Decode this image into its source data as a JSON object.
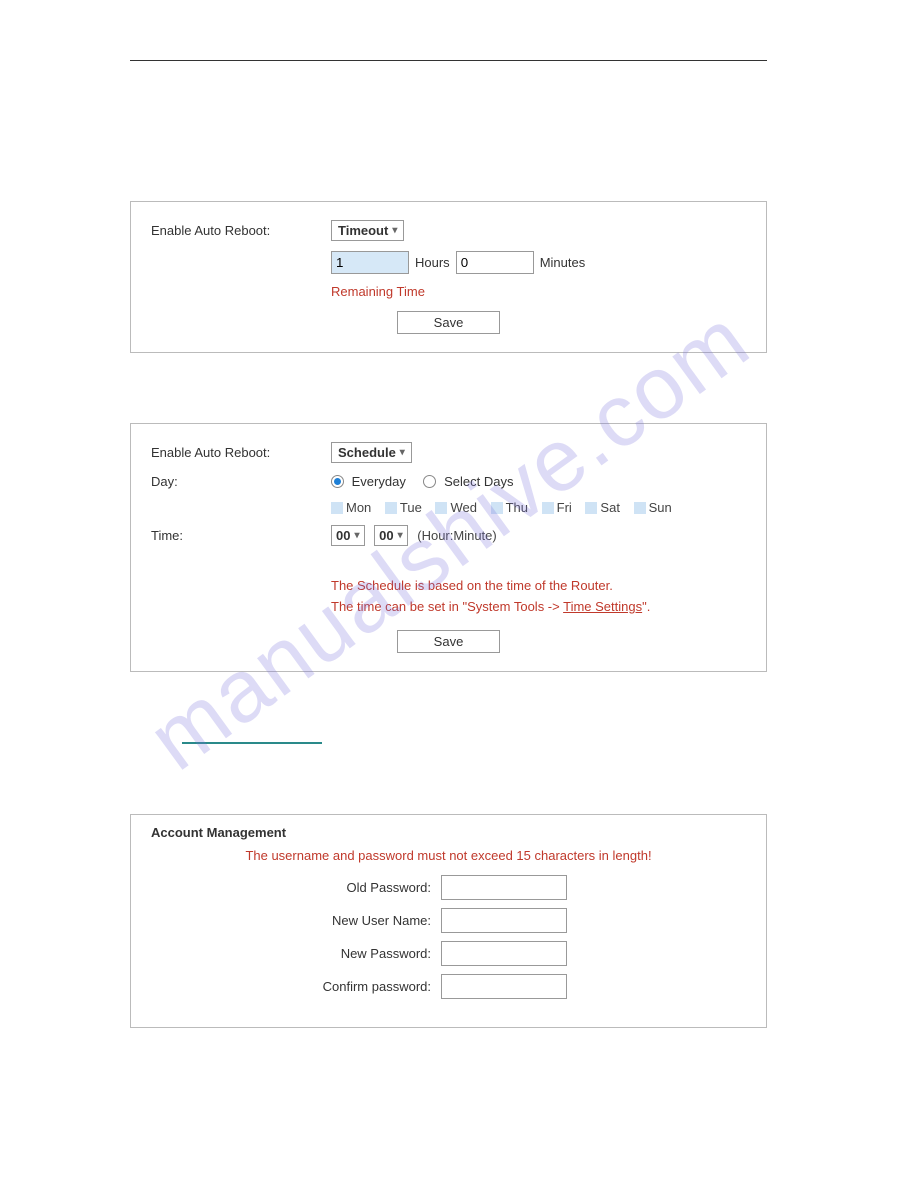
{
  "watermark": "manualshive.com",
  "panel1": {
    "label": "Enable Auto Reboot:",
    "mode": "Timeout",
    "hours_value": "1",
    "hours_label": "Hours",
    "minutes_value": "0",
    "minutes_label": "Minutes",
    "remaining": "Remaining Time",
    "save": "Save"
  },
  "panel2": {
    "label": "Enable Auto Reboot:",
    "mode": "Schedule",
    "day_label": "Day:",
    "everyday": "Everyday",
    "select_days": "Select Days",
    "days": [
      "Mon",
      "Tue",
      "Wed",
      "Thu",
      "Fri",
      "Sat",
      "Sun"
    ],
    "time_label": "Time:",
    "hour_sel": "00",
    "min_sel": "00",
    "time_hint": "(Hour:Minute)",
    "note1": "The Schedule is based on the time of the Router.",
    "note2_a": "The time can be set in \"System Tools -> ",
    "note2_link": "Time Settings",
    "note2_b": "\".",
    "save": "Save"
  },
  "account": {
    "title": "Account Management",
    "warn": "The username and password must not exceed 15 characters in length!",
    "old_pw": "Old Password:",
    "new_user": "New User Name:",
    "new_pw": "New Password:",
    "confirm_pw": "Confirm password:"
  }
}
